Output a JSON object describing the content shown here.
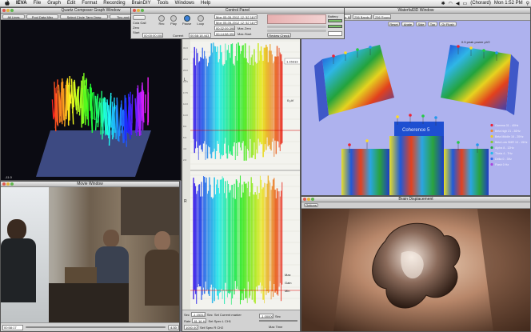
{
  "menubar": {
    "app": "IEVA",
    "items": [
      "File",
      "Graph",
      "Edit",
      "Format",
      "Recording",
      "BrainDIY",
      "Tools",
      "Windows",
      "Help"
    ],
    "user": "(Chorard)",
    "clock": "Mon 1:52 PM"
  },
  "qc": {
    "title": "Quartz Composer Graph Window",
    "buttons": [
      "All Lines",
      "Pool Data Mtrx",
      "Select Circle Tarry Draw",
      "Tiny and flake at rnd"
    ],
    "corner_text": "-11.0"
  },
  "control": {
    "title": "Control Panel",
    "left_labels": [
      "Cola Gail",
      "Zero",
      "Start"
    ],
    "transport": [
      "Rec",
      "Play",
      "Pause",
      "Loop"
    ],
    "start_value": "00:00:00.000",
    "current_label": "Current",
    "current_value": "00:58:18.443",
    "date1": "Mon 05-05-2012 12: 52 18 PM",
    "date2": "Mon 05-05-2012 12: 52 18 PM",
    "time1": "00:32:09.395",
    "time2": "00:14:58.391",
    "max_zero": "Max-Zero",
    "max_start": "Max-Start",
    "battery_label": "Battery",
    "review_check": "Review Check"
  },
  "wave": {
    "top_value": "1.15313",
    "side_label": "0 µV",
    "L": "L",
    "R": "R",
    "left_ticks": [
      "31.0",
      "26.0",
      "23.0",
      "19.5",
      "17.5",
      "14.0",
      "11.0",
      "8.0",
      "6.0",
      "4.0",
      "2.0"
    ],
    "bottom": {
      "sec_label": "Sec",
      "sec_value": "-1.15313",
      "sec_unit": "Sec",
      "current_marker": "Set Current marker",
      "rate_label": "Rate",
      "rate_value": "81.16 Hz",
      "avg_value": "1000.00",
      "ch1": "Set Spec L CH1",
      "ch2": "Set Spec R CH2",
      "sec_right_value": "-1.00000",
      "sec_right_unit": "Sec",
      "max_time": "Max Time",
      "gain": "Gain",
      "side_labels": [
        "Max",
        "Gain",
        "Min"
      ]
    }
  },
  "movie": {
    "title": "Movie Window",
    "timecode": "00:58:17",
    "right": "4.30"
  },
  "waterfall": {
    "title": "Waterfall3D Window",
    "tb_fields": [
      "00:58:18.443",
      "1-4667 Hz Max",
      "256 Bands FFT",
      "256 Rounding"
    ],
    "tb_buttons": [
      "Reset",
      "Angle",
      "Side",
      "Top",
      "Gr Flush"
    ],
    "top_note": "0.5 peak power μV2",
    "center_label": "Coherence 5",
    "legend": [
      "Gamma 31 - 40Hz",
      "Beta high 21 - 30Hz",
      "Beta Middle 16 - 20Hz",
      "Beta Low SMR 13 - 15Hz",
      "Alpha 8 - 12Hz",
      "Theta 4 - 7Hz",
      "Delta 0 - 3Hz",
      "Flash 0 Hz"
    ]
  },
  "brain": {
    "title": "Brain Displacement",
    "button": "Options"
  },
  "colors": {
    "qc_bg": "#0b0b12",
    "waterfall_bg": "#aeb2ee",
    "menubar": "#dcdcdc"
  }
}
